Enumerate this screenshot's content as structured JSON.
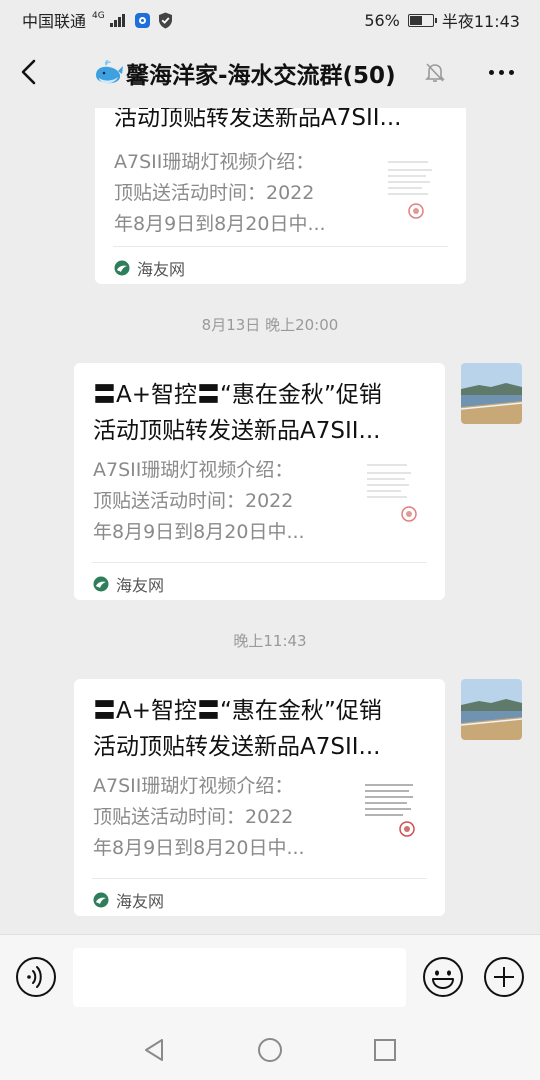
{
  "status_bar": {
    "carrier": "中国联通",
    "network": "4G",
    "battery_percent": "56%",
    "battery_level": 0.56,
    "time": "半夜11:43"
  },
  "header": {
    "title": "馨海洋家-海水交流群(50)",
    "icons": [
      "back-arrow-icon",
      "whale-emoji-icon",
      "mute-bell-icon",
      "more-dots-icon"
    ]
  },
  "messages": [
    {
      "title_line2": "活动顶贴转发送新品A7SII...",
      "desc": [
        "A7SII珊瑚灯视频介绍：",
        "顶贴送活动时间：2022",
        "年8月9日到8月20日中..."
      ],
      "source": "海友网"
    },
    {
      "timestamp": "8月13日 晚上20:00",
      "title_line1": "〓A+智控〓“惠在金秋”促销",
      "title_line2": "活动顶贴转发送新品A7SII...",
      "desc": [
        "A7SII珊瑚灯视频介绍：",
        "顶贴送活动时间：2022",
        "年8月9日到8月20日中..."
      ],
      "source": "海友网"
    },
    {
      "timestamp": "晚上11:43",
      "title_line1": "〓A+智控〓“惠在金秋”促销",
      "title_line2": "活动顶贴转发送新品A7SII...",
      "desc": [
        "A7SII珊瑚灯视频介绍：",
        "顶贴送活动时间：2022",
        "年8月9日到8月20日中..."
      ],
      "source": "海友网"
    }
  ],
  "input_bar": {
    "icons": [
      "voice-icon",
      "emoji-icon",
      "plus-icon"
    ]
  },
  "nav_bar": {
    "icons": [
      "nav-back-icon",
      "nav-home-icon",
      "nav-recents-icon"
    ]
  },
  "colors": {
    "background": "#ededed",
    "card": "#ffffff",
    "muted_text": "#8a8a8a",
    "source_icon": "#2e7d5b"
  }
}
